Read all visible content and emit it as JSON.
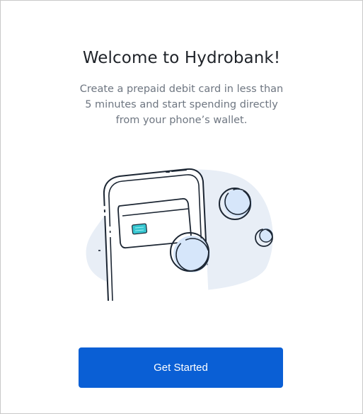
{
  "onboarding": {
    "title": "Welcome to Hydrobank!",
    "description": "Create a prepaid debit card in less than 5 minutes and start spending directly from your phone’s wallet.",
    "illustration": "phone-card-coins-illustration",
    "cta_label": "Get Started"
  },
  "colors": {
    "primary": "#0a5fd5",
    "title_text": "#1f2329",
    "body_text": "#6e7681",
    "illustration_line": "#1c2633",
    "illustration_fill": "#e8eef6",
    "coin_fill": "#d6e6fa",
    "chip": "#37c6d0"
  }
}
